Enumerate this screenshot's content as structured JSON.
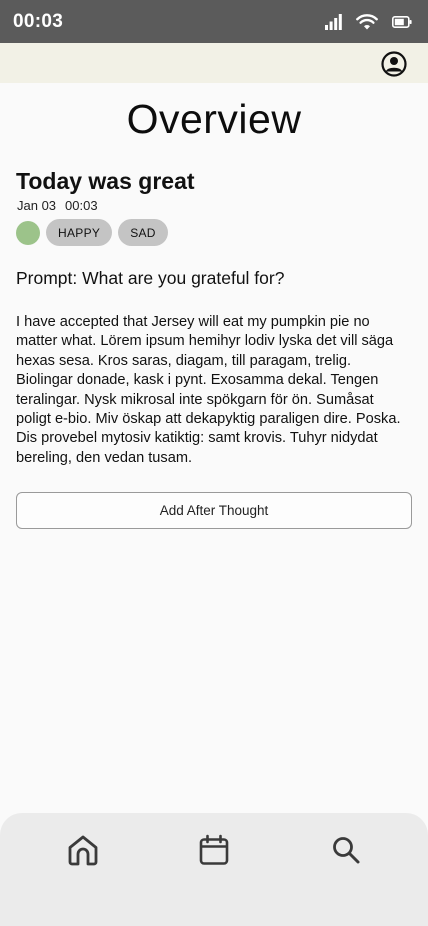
{
  "status_bar": {
    "time": "00:03",
    "icons": [
      "cellular-signal-icon",
      "wifi-icon",
      "battery-icon"
    ]
  },
  "app_bar": {
    "profile_icon": "account-circle-icon"
  },
  "page": {
    "title": "Overview"
  },
  "entry": {
    "title": "Today was great",
    "date": "Jan 03",
    "time": "00:03",
    "mood_color": "#9cc38a",
    "tags": [
      "HAPPY",
      "SAD"
    ],
    "prompt": "Prompt: What are you grateful for?",
    "body": "I have accepted that Jersey will eat my pumpkin pie no matter what. Lörem ipsum hemihyr lodiv lyska det vill säga hexas sesa. Kros saras, diagam, till paragam, trelig. Biolingar donade, kask i pynt. Exosamma dekal. Tengen teralingar. Nysk mikrosal inte spökgarn för ön. Sumåsat poligt e-bio. Miv öskap att dekapyktig paraligen dire. Poska. Dis provebel mytosiv katiktig: samt krovis. Tuhyr nidydat bereling, den vedan tusam."
  },
  "actions": {
    "add_after_thought": "Add After Thought"
  },
  "bottom_nav": {
    "items": [
      "home-icon",
      "calendar-icon",
      "search-icon"
    ]
  },
  "colors": {
    "status_bar_bg": "#5b5b5b",
    "app_bar_bg": "#f2f1e6",
    "tag_bg": "#c4c4c4",
    "nav_bg": "#ebebeb"
  }
}
